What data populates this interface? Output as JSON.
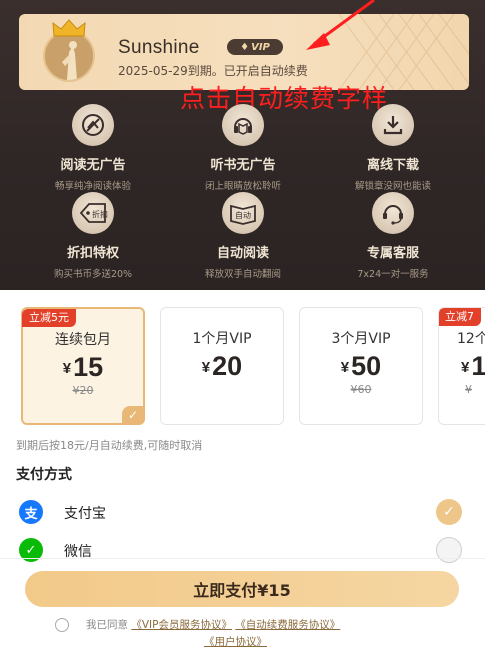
{
  "membership": {
    "username": "Sunshine",
    "vip_badge": "VIP",
    "status_text": "2025-05-29到期。已开启自动续费"
  },
  "annotation": {
    "text": "点击自动续费字样",
    "color": "#ff1e1e"
  },
  "features": [
    {
      "title": "阅读无广告",
      "subtitle": "畅享纯净阅读体验",
      "icon": "no-ads-reading-icon"
    },
    {
      "title": "听书无广告",
      "subtitle": "闭上眼睛放松聆听",
      "icon": "headphones-book-icon"
    },
    {
      "title": "离线下载",
      "subtitle": "解锁章没网也能读",
      "icon": "download-icon"
    },
    {
      "title": "折扣特权",
      "subtitle": "购买书币多送20%",
      "icon": "discount-tag-icon",
      "icon_text": "折扣"
    },
    {
      "title": "自动阅读",
      "subtitle": "释放双手自动翻阅",
      "icon": "auto-read-icon",
      "icon_text": "自动"
    },
    {
      "title": "专属客服",
      "subtitle": "7x24一对一服务",
      "icon": "customer-service-icon"
    }
  ],
  "plans": [
    {
      "badge": "立减5元",
      "name": "连续包月",
      "currency": "¥",
      "price": "15",
      "original": "¥20",
      "selected": true
    },
    {
      "badge": "",
      "name": "1个月VIP",
      "currency": "¥",
      "price": "20",
      "original": "",
      "selected": false
    },
    {
      "badge": "",
      "name": "3个月VIP",
      "currency": "¥",
      "price": "50",
      "original": "¥60",
      "selected": false
    },
    {
      "badge": "立减7",
      "name": "12个",
      "currency": "¥",
      "price": "1",
      "original": "¥",
      "selected": false
    }
  ],
  "renew_note": "到期后按18元/月自动续费,可随时取消",
  "payment": {
    "title": "支付方式",
    "methods": [
      {
        "label": "支付宝",
        "icon": "alipay-icon",
        "color": "#1677ff",
        "selected": true
      },
      {
        "label": "微信",
        "icon": "wechat-pay-icon",
        "color": "#09bb07",
        "selected": false
      }
    ]
  },
  "pay_button": "立即支付¥15",
  "agreement": {
    "prefix": "我已同意",
    "link1": "《VIP会员服务协议》",
    "link2": "《自动续费服务协议》",
    "link3": "《用户协议》"
  },
  "colors": {
    "accent": "#e9b877",
    "dark_bg": "#2f2726",
    "badge_red": "#e3402a"
  }
}
